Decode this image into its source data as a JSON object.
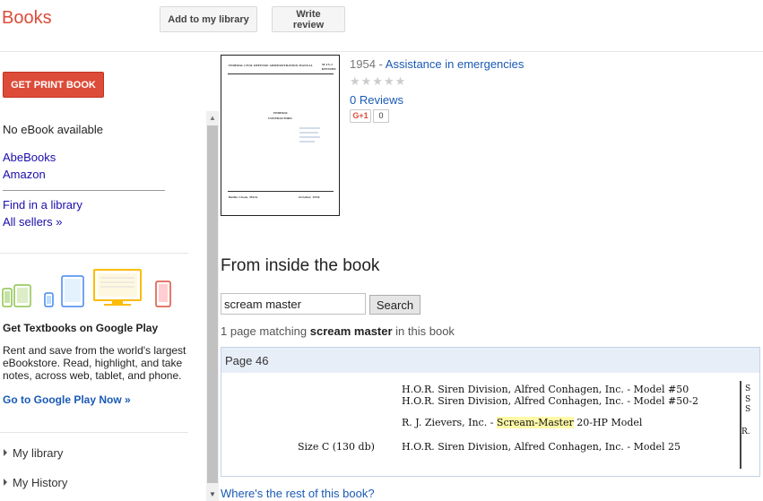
{
  "header": {
    "brand": "Books",
    "add_library": "Add to my library",
    "write_review": "Write review"
  },
  "sidebar": {
    "print_button": "GET PRINT BOOK",
    "no_ebook": "No eBook available",
    "sellers": [
      "AbeBooks",
      "Amazon"
    ],
    "find_library": "Find in a library",
    "all_sellers": "All sellers »",
    "promo": {
      "title": "Get Textbooks on Google Play",
      "text": "Rent and save from the world's largest eBookstore. Read, highlight, and take notes, across web, tablet, and phone.",
      "link": "Go to Google Play Now »"
    },
    "nav": [
      "My library",
      "My History"
    ]
  },
  "book": {
    "year": "1954 -",
    "title": "Assistance in emergencies",
    "rating_stars": "★★★★★",
    "reviews": "0 Reviews",
    "gplus": "G+1",
    "gplus_count": "0",
    "cover": {
      "header_left": "FEDERAL CIVIL DEFENSE ADMINISTRATION MANUAL",
      "header_right": "M-15-1",
      "header_right_2": "REVISED",
      "title_1": "FEDERAL",
      "title_2": "CONTRACTORS",
      "footer_left": "Battle Creek, Mich.",
      "footer_right": "October, 1954"
    }
  },
  "inside": {
    "title": "From inside the book",
    "query": "scream master",
    "search_button": "Search",
    "match_prefix": "1 page matching",
    "match_term": "scream master",
    "match_suffix": "in this book",
    "page_label": "Page 46",
    "snippet": {
      "line1": "H.O.R. Siren Division, Alfred Conhagen, Inc. - Model #50",
      "line2": "H.O.R. Siren Division, Alfred Conhagen, Inc. - Model #50-2",
      "line3_pre": "R. J. Zievers, Inc. -",
      "line3_hl1": "Scream-",
      "line3_hl2": "Master",
      "line3_post": "20-HP Model",
      "size_label": "Size C (130 db)",
      "line4": "H.O.R. Siren Division, Alfred Conhagen, Inc. - Model 25",
      "edge_chars": [
        "S",
        "S",
        "S",
        "R."
      ]
    },
    "rest_link": "Where's the rest of this book?"
  },
  "colors": {
    "brand": "#dd4b39",
    "link": "#1a5ab5",
    "highlight": "#fff9a8"
  }
}
